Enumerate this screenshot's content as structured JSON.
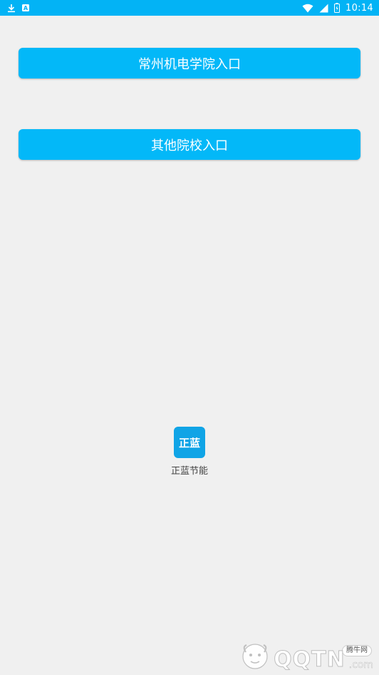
{
  "status_bar": {
    "time": "10:14",
    "icons": [
      "download-icon",
      "notification-a-icon",
      "wifi-icon",
      "signal-icon",
      "battery-icon"
    ],
    "background": "#03b3f5"
  },
  "buttons": [
    {
      "label": "常州机电学院入口"
    },
    {
      "label": "其他院校入口"
    }
  ],
  "app": {
    "icon_text": "正蓝",
    "name": "正蓝节能"
  },
  "watermark": {
    "site": "QQTN",
    "suffix": ".com",
    "badge": "腾牛网"
  },
  "colors": {
    "accent": "#03b8f8",
    "background": "#f0f0f0",
    "app_icon": "#10a4e6"
  }
}
